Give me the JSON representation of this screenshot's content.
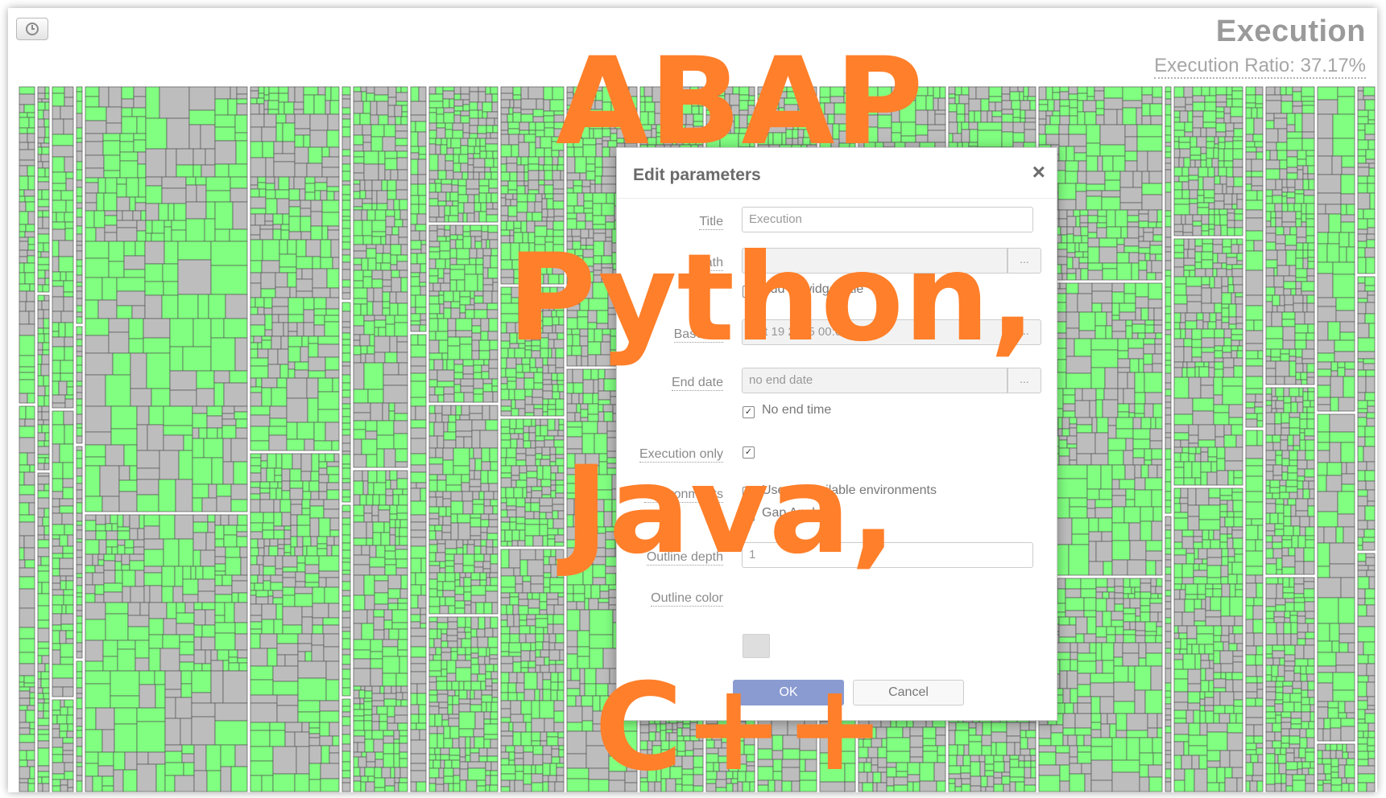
{
  "widget": {
    "title": "Execution",
    "ratio_text": "Execution Ratio: 37.17%",
    "button_icon": "clock-icon"
  },
  "colors": {
    "covered": "#80ff80",
    "uncovered": "#bdbdbd",
    "overlay_text": "#ff7f2a",
    "ok_button": "#8a9bd1"
  },
  "dialog": {
    "title": "Edit parameters",
    "close": "×",
    "fields": {
      "title_label": "Title",
      "title_value": "Execution",
      "path_label": "Path",
      "path_value": "",
      "path_button": "...",
      "add_to_title_label": "Add to widget title",
      "baseline_label": "Baseline",
      "baseline_value": "Oct 19 2015 00:00",
      "baseline_button": "...",
      "end_date_label": "End date",
      "end_date_placeholder": "no end date",
      "end_date_button": "...",
      "no_end_time_label": "No end time",
      "execution_only_label": "Execution only",
      "environments_label": "Environments",
      "use_all_envs_label": "Use all available environments",
      "gap_analysis_label": "Gap Analysis",
      "outline_depth_label": "Outline depth",
      "outline_depth_value": "1",
      "outline_color_label": "Outline color"
    },
    "ok_label": "OK",
    "cancel_label": "Cancel"
  },
  "overlay": {
    "line1": "ABAP",
    "line2": "Python,",
    "line3": "Java,",
    "line4": "C++"
  }
}
